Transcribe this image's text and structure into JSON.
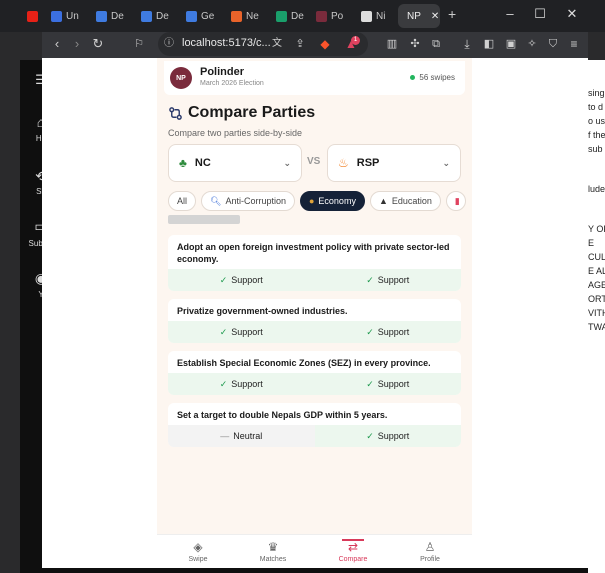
{
  "browser": {
    "tabs": [
      {
        "label": "Un",
        "color": "#3b6fe0"
      },
      {
        "label": "De",
        "color": "#3f7be0"
      },
      {
        "label": "De",
        "color": "#3f7be0"
      },
      {
        "label": "Ge",
        "color": "#3f7be0"
      },
      {
        "label": "Ne",
        "color": "#e8632a"
      },
      {
        "label": "De",
        "color": "#1a9f6b"
      },
      {
        "label": "Po",
        "color": "#7a2b3c"
      },
      {
        "label": "Ni",
        "color": "#dddddd"
      },
      {
        "label": "NP",
        "color": "#7a2b3c"
      }
    ],
    "url": "localhost:5173/c...",
    "extension_badge": "1"
  },
  "background_app": {
    "sidebar_items": [
      "Ho",
      "Sh",
      "Subscr",
      "Y"
    ],
    "right_text": [
      "sing",
      "to d",
      "o us",
      "f the",
      "sub",
      "lude",
      "Y OF",
      "E",
      "CUL",
      "E AL",
      "AGE",
      "ORT",
      "VITH",
      "TWA"
    ]
  },
  "app": {
    "brand": "Polinder",
    "brand_subtitle": "March 2026 Election",
    "logo_text": "NP",
    "swipes": "56 swipes",
    "page_title": "Compare Parties",
    "page_subtitle": "Compare two parties side-by-side",
    "party_left": {
      "name": "NC",
      "icon": "tree-icon"
    },
    "party_right": {
      "name": "RSP",
      "icon": "flame-icon"
    },
    "vs_label": "VS",
    "categories": [
      {
        "label": "All",
        "icon": "",
        "active": false
      },
      {
        "label": "Anti-Corruption",
        "icon": "search-icon",
        "active": false
      },
      {
        "label": "Economy",
        "icon": "money-bag-icon",
        "active": true
      },
      {
        "label": "Education",
        "icon": "graduation-cap-icon",
        "active": false
      }
    ],
    "statements": [
      {
        "text": "Adopt an open foreign investment policy with private sector-led economy.",
        "left": "Support",
        "right": "Support"
      },
      {
        "text": "Privatize government-owned industries.",
        "left": "Support",
        "right": "Support"
      },
      {
        "text": "Establish Special Economic Zones (SEZ) in every province.",
        "left": "Support",
        "right": "Support"
      },
      {
        "text": "Set a target to double Nepals GDP within 5 years.",
        "left": "Neutral",
        "right": "Support"
      }
    ],
    "nav": [
      {
        "label": "Swipe",
        "icon": "layers-icon",
        "active": false
      },
      {
        "label": "Matches",
        "icon": "trophy-icon",
        "active": false
      },
      {
        "label": "Compare",
        "icon": "compare-icon",
        "active": true
      },
      {
        "label": "Profile",
        "icon": "user-icon",
        "active": false
      }
    ]
  }
}
